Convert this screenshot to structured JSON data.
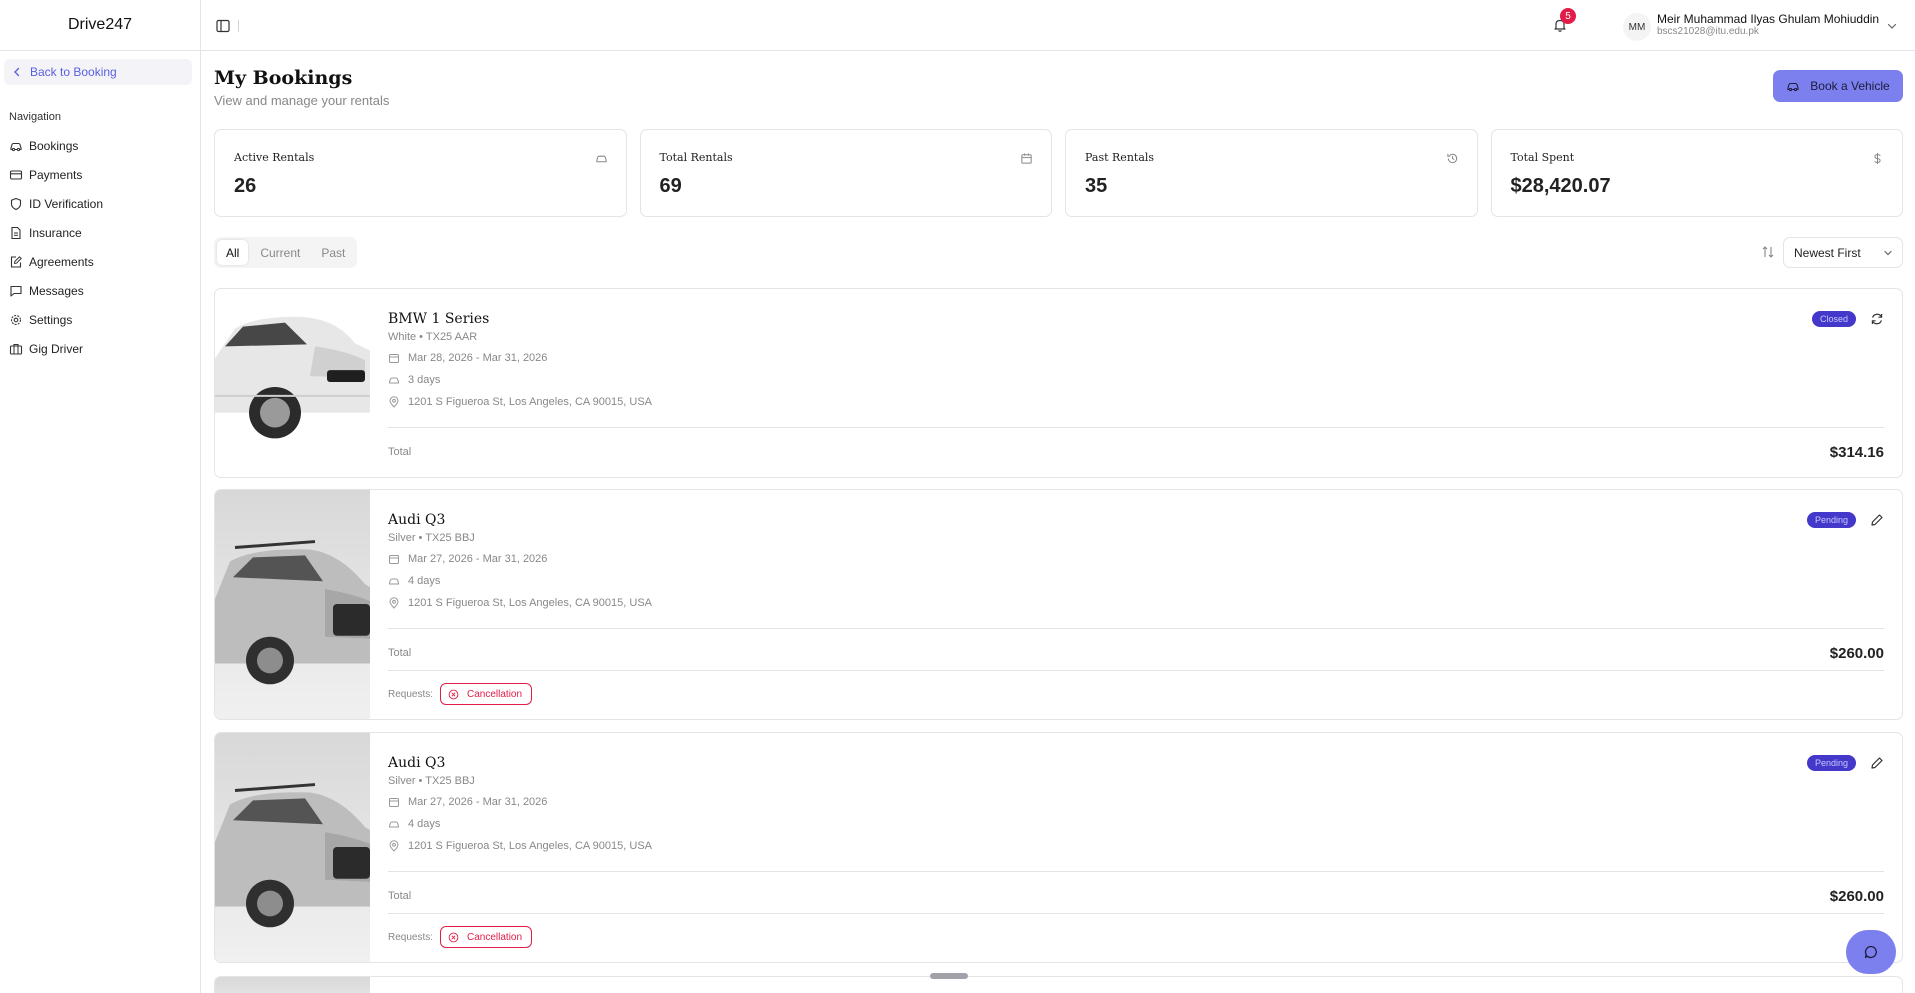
{
  "app": {
    "brand": "Drive247"
  },
  "sidebar": {
    "back_label": "Back to Booking",
    "nav_title": "Navigation",
    "items": [
      {
        "label": "Bookings",
        "icon": "car-icon"
      },
      {
        "label": "Payments",
        "icon": "credit-card-icon"
      },
      {
        "label": "ID Verification",
        "icon": "shield-icon"
      },
      {
        "label": "Insurance",
        "icon": "document-icon"
      },
      {
        "label": "Agreements",
        "icon": "edit-document-icon"
      },
      {
        "label": "Messages",
        "icon": "message-icon"
      },
      {
        "label": "Settings",
        "icon": "gear-icon"
      },
      {
        "label": "Gig Driver",
        "icon": "briefcase-icon"
      }
    ]
  },
  "header": {
    "notification_count": "5",
    "user": {
      "initials": "MM",
      "name": "Meir Muhammad Ilyas Ghulam Mohiuddin",
      "email": "bscs21028@itu.edu.pk"
    }
  },
  "page": {
    "title": "My Bookings",
    "subtitle": "View and manage your rentals",
    "book_button": "Book a Vehicle"
  },
  "stats": [
    {
      "label": "Active Rentals",
      "value": "26",
      "icon": "car-icon"
    },
    {
      "label": "Total Rentals",
      "value": "69",
      "icon": "calendar-icon"
    },
    {
      "label": "Past Rentals",
      "value": "35",
      "icon": "history-icon"
    },
    {
      "label": "Total Spent",
      "value": "$28,420.07",
      "icon": "dollar-icon"
    }
  ],
  "filters": {
    "tabs": [
      "All",
      "Current",
      "Past"
    ],
    "active": "All",
    "sort": "Newest First"
  },
  "bookings": [
    {
      "name": "BMW 1 Series",
      "sub": "White • TX25 AAR",
      "dates": "Mar 28, 2026 - Mar 31, 2026",
      "duration": "3 days",
      "address": "1201 S Figueroa St, Los Angeles, CA 90015, USA",
      "total_label": "Total",
      "total": "$314.16",
      "status": "Closed",
      "action_icon": "refresh-icon"
    },
    {
      "name": "Audi Q3",
      "sub": "Silver • TX25 BBJ",
      "dates": "Mar 27, 2026 - Mar 31, 2026",
      "duration": "4 days",
      "address": "1201 S Figueroa St, Los Angeles, CA 90015, USA",
      "total_label": "Total",
      "total": "$260.00",
      "status": "Pending",
      "action_icon": "pencil-icon",
      "requests_label": "Requests:",
      "request": "Cancellation"
    },
    {
      "name": "Audi Q3",
      "sub": "Silver • TX25 BBJ",
      "dates": "Mar 27, 2026 - Mar 31, 2026",
      "duration": "4 days",
      "address": "1201 S Figueroa St, Los Angeles, CA 90015, USA",
      "total_label": "Total",
      "total": "$260.00",
      "status": "Pending",
      "action_icon": "pencil-icon",
      "requests_label": "Requests:",
      "request": "Cancellation"
    }
  ],
  "colors": {
    "accent": "#7b80ee",
    "badge": "#4338ca",
    "danger": "#e11d48"
  }
}
